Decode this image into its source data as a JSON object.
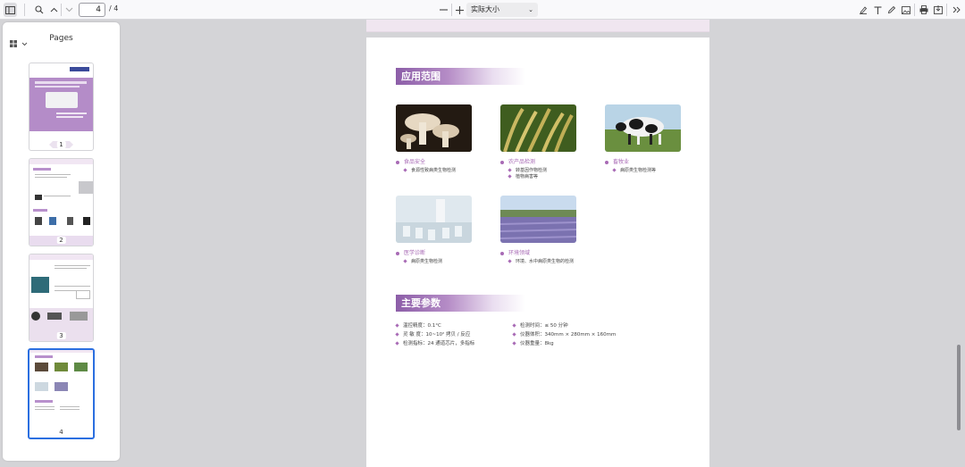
{
  "toolbar": {
    "current_page": "4",
    "page_total": "/ 4",
    "zoom_label": "实际大小",
    "icons": [
      "sidebar-toggle-icon",
      "search-icon",
      "prev-page-icon",
      "next-page-icon",
      "zoom-out-icon",
      "zoom-in-icon",
      "highlight-icon",
      "text-icon",
      "draw-icon",
      "image-icon",
      "print-icon",
      "save-icon",
      "more-tools-icon"
    ]
  },
  "sidebar": {
    "title": "Pages",
    "thumbnails": [
      {
        "label": "1"
      },
      {
        "label": "2"
      },
      {
        "label": "3"
      },
      {
        "label": "4",
        "selected": true
      }
    ]
  },
  "document": {
    "section1_title": "应用范围",
    "applications": [
      {
        "category": "食品安全",
        "items": [
          "食源性致病类生物检测"
        ],
        "photo": "mushrooms"
      },
      {
        "category": "农产品检测",
        "items": [
          "转基因作物检测",
          "植物病害等"
        ],
        "photo": "rice"
      },
      {
        "category": "畜牧业",
        "items": [
          "病原类生物检测等"
        ],
        "photo": "cow"
      },
      {
        "category": "医学诊断",
        "items": [
          "病原类生物检测"
        ],
        "photo": "lab"
      },
      {
        "category": "环境领域",
        "items": [
          "环境、水中病原类生物的检测"
        ],
        "photo": "lavender"
      }
    ],
    "section2_title": "主要参数",
    "params_left": [
      "温控精度：0.1°C",
      "灵 敏 度：10~10² 拷贝 / 反应",
      "检测指标：24 通道芯片，多指标"
    ],
    "params_right": [
      "检测时间：≤ 50 分钟",
      "仪器体积：340mm × 280mm × 160mm",
      "仪器重量：8kg"
    ]
  },
  "colors": {
    "accent_purple": "#a86ab5",
    "selection_blue": "#2b6fe0",
    "viewer_background": "#d4d4d7"
  }
}
